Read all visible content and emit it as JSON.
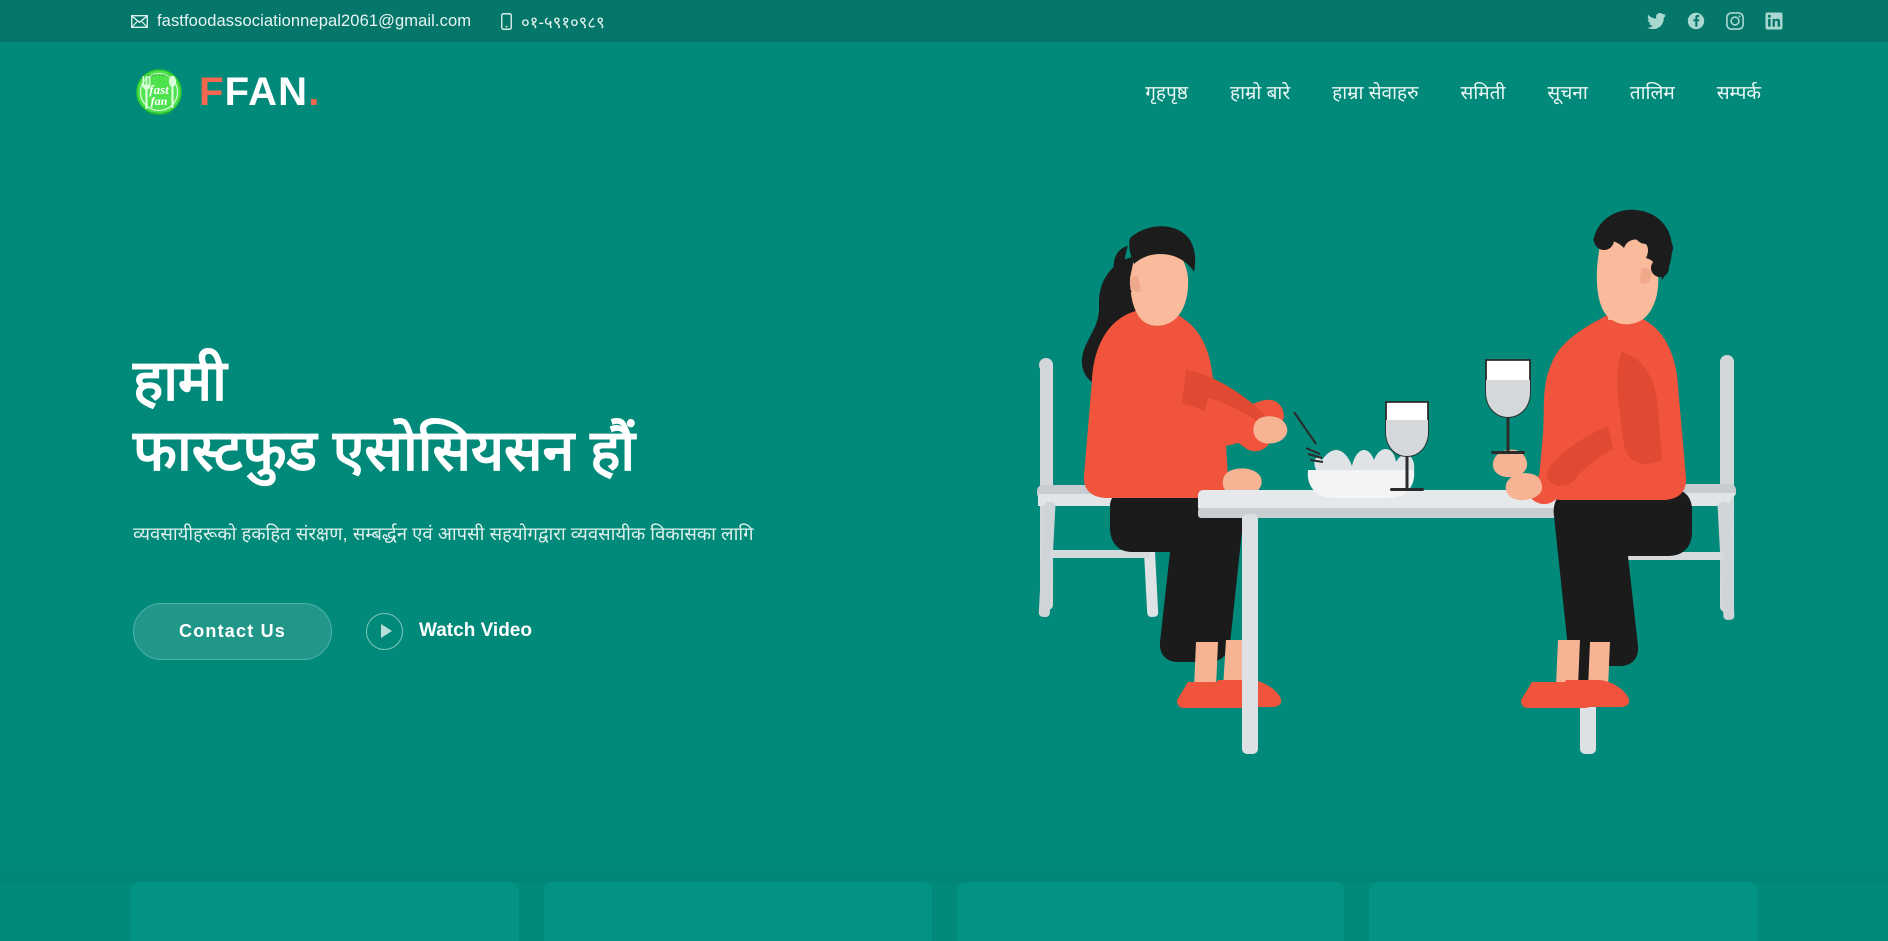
{
  "topbar": {
    "email": "fastfoodassociationnepal2061@gmail.com",
    "email_icon": "envelope-icon",
    "phone": "०१-५९१०९८९",
    "phone_icon": "mobile-phone-icon",
    "socials": [
      {
        "name": "twitter-icon",
        "label": "Twitter"
      },
      {
        "name": "facebook-icon",
        "label": "Facebook"
      },
      {
        "name": "instagram-icon",
        "label": "Instagram"
      },
      {
        "name": "linkedin-icon",
        "label": "LinkedIn"
      }
    ],
    "background": "#04766a"
  },
  "brand": {
    "logo_icon": "ffan-circular-logo",
    "logo_text_inner_top": "fast",
    "logo_text_inner_bottom": "fan",
    "name_first": "F",
    "name_rest": "FAN",
    "name_dot": ".",
    "accent_color": "#f4674f"
  },
  "nav": {
    "items": [
      {
        "label": "गृहपृष्ठ",
        "name": "nav-item-home"
      },
      {
        "label": "हाम्रो बारे",
        "name": "nav-item-about"
      },
      {
        "label": "हाम्रा सेवाहरु",
        "name": "nav-item-services"
      },
      {
        "label": "समिती",
        "name": "nav-item-committee"
      },
      {
        "label": "सूचना",
        "name": "nav-item-notices"
      },
      {
        "label": "तालिम",
        "name": "nav-item-training"
      },
      {
        "label": "सम्पर्क",
        "name": "nav-item-contact"
      }
    ]
  },
  "hero": {
    "title": "हामी\nफास्टफुड एसोसियसन हौं",
    "subtitle": "व्यवसायीहरूको हकहित संरक्षण, सम्बर्द्धन एवं आपसी सहयोगद्वारा व्यवसायीक विकासका लागि",
    "contact_button": "Contact Us",
    "watch_label": "Watch Video",
    "watch_icon": "play-circle-icon",
    "illustration": "two-people-dining-at-table-illustration"
  },
  "cards": [
    {
      "name": "feature-card-1"
    },
    {
      "name": "feature-card-2"
    },
    {
      "name": "feature-card-3"
    },
    {
      "name": "feature-card-4"
    }
  ],
  "colors": {
    "page_background": "#018a7a",
    "topbar_background": "#04766a",
    "card_background": "#029384",
    "accent_orange": "#f0543c",
    "text_light": "#eaf6f3"
  }
}
